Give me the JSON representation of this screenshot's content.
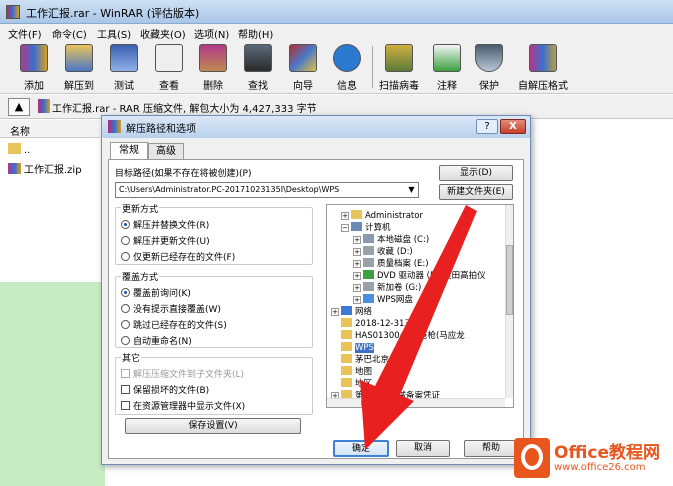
{
  "window": {
    "title": "工作汇报.rar - WinRAR (评估版本)"
  },
  "menu": [
    "文件(F)",
    "命令(C)",
    "工具(S)",
    "收藏夹(O)",
    "选项(N)",
    "帮助(H)"
  ],
  "toolbar": {
    "items": [
      {
        "label": "添加",
        "icon": "add-books-icon",
        "color": "#b03a8a"
      },
      {
        "label": "解压到",
        "icon": "extract-folder-icon",
        "color": "#4a78c8"
      },
      {
        "label": "测试",
        "icon": "test-clipboard-icon",
        "color": "#3a5fb0"
      },
      {
        "label": "查看",
        "icon": "view-glasses-icon",
        "color": "#e8e8e8"
      },
      {
        "label": "删除",
        "icon": "delete-box-icon",
        "color": "#c08a50"
      },
      {
        "label": "查找",
        "icon": "find-binoculars-icon",
        "color": "#5a6a7a"
      },
      {
        "label": "向导",
        "icon": "wizard-wand-icon",
        "color": "#b03030"
      },
      {
        "label": "信息",
        "icon": "info-icon",
        "color": "#2a7ad0"
      },
      {
        "label": "扫描病毒",
        "icon": "virus-scan-icon",
        "color": "#d0b040"
      },
      {
        "label": "注释",
        "icon": "comment-pen-icon",
        "color": "#3aa040"
      },
      {
        "label": "保护",
        "icon": "protect-shield-icon",
        "color": "#4a5a6a"
      },
      {
        "label": "自解压格式",
        "icon": "sfx-box-icon",
        "color": "#b8a040"
      }
    ]
  },
  "addressbar": {
    "text": "工作汇报.rar - RAR 压缩文件, 解包大小为 4,427,333 字节"
  },
  "filelist": {
    "header": "名称",
    "items": [
      {
        "name": ".."
      },
      {
        "name": "工作汇报.zip"
      }
    ]
  },
  "dialog": {
    "title": "解压路径和选项",
    "help": "?",
    "close": "X",
    "tabs": [
      "常规",
      "高级"
    ],
    "target_label": "目标路径(如果不存在将被创建)(P)",
    "target_path": "C:\\Users\\Administrator.PC-20171023135I\\Desktop\\WPS",
    "show_button": "显示(D)",
    "newfolder_button": "新建文件夹(E)",
    "update_group": {
      "title": "更新方式",
      "options": [
        "解压并替换文件(R)",
        "解压并更新文件(U)",
        "仅更新已经存在的文件(F)"
      ]
    },
    "overwrite_group": {
      "title": "覆盖方式",
      "options": [
        "覆盖前询问(K)",
        "没有提示直接覆盖(W)",
        "跳过已经存在的文件(S)",
        "自动重命名(N)"
      ]
    },
    "other_group": {
      "title": "其它",
      "options": [
        "解压压缩文件到子文件夹(L)",
        "保留损坏的文件(B)",
        "在资源管理器中显示文件(X)"
      ]
    },
    "save_button": "保存设置(V)",
    "tree": [
      {
        "text": "Administrator",
        "toggle": "+",
        "level": 1
      },
      {
        "text": "计算机",
        "toggle": "−",
        "level": 1
      },
      {
        "text": "本地磁盘 (C:)",
        "toggle": "+",
        "level": 2
      },
      {
        "text": "收藏 (D:)",
        "toggle": "+",
        "level": 2
      },
      {
        "text": "质量档案 (E:)",
        "toggle": "+",
        "level": 2
      },
      {
        "text": "DVD 驱动器 (F:) 良田高拍仪",
        "toggle": "+",
        "level": 2
      },
      {
        "text": "新加卷 (G:)",
        "toggle": "+",
        "level": 2
      },
      {
        "text": "WPS网盘",
        "toggle": "+",
        "level": 2
      },
      {
        "text": "网络",
        "toggle": "+",
        "level": 1
      },
      {
        "text": "2018-12-31三天月",
        "toggle": "",
        "level": 1
      },
      {
        "text": "HAS0130040痔疮枪(马应龙",
        "toggle": "",
        "level": 1
      },
      {
        "text": "WPS",
        "toggle": "",
        "level": 1,
        "selected": true
      },
      {
        "text": "茅巴北京信宣",
        "toggle": "",
        "level": 1
      },
      {
        "text": "地图",
        "toggle": "",
        "level": 1
      },
      {
        "text": "地区",
        "toggle": "",
        "level": 1
      },
      {
        "text": "第一医疗器械备案凭证",
        "toggle": "+",
        "level": 1
      }
    ],
    "ok": "确定",
    "cancel": "取消",
    "help_button": "帮助"
  },
  "watermark": {
    "brand": "Office教程网",
    "url": "www.office26.com",
    "color": "#e8561d"
  }
}
